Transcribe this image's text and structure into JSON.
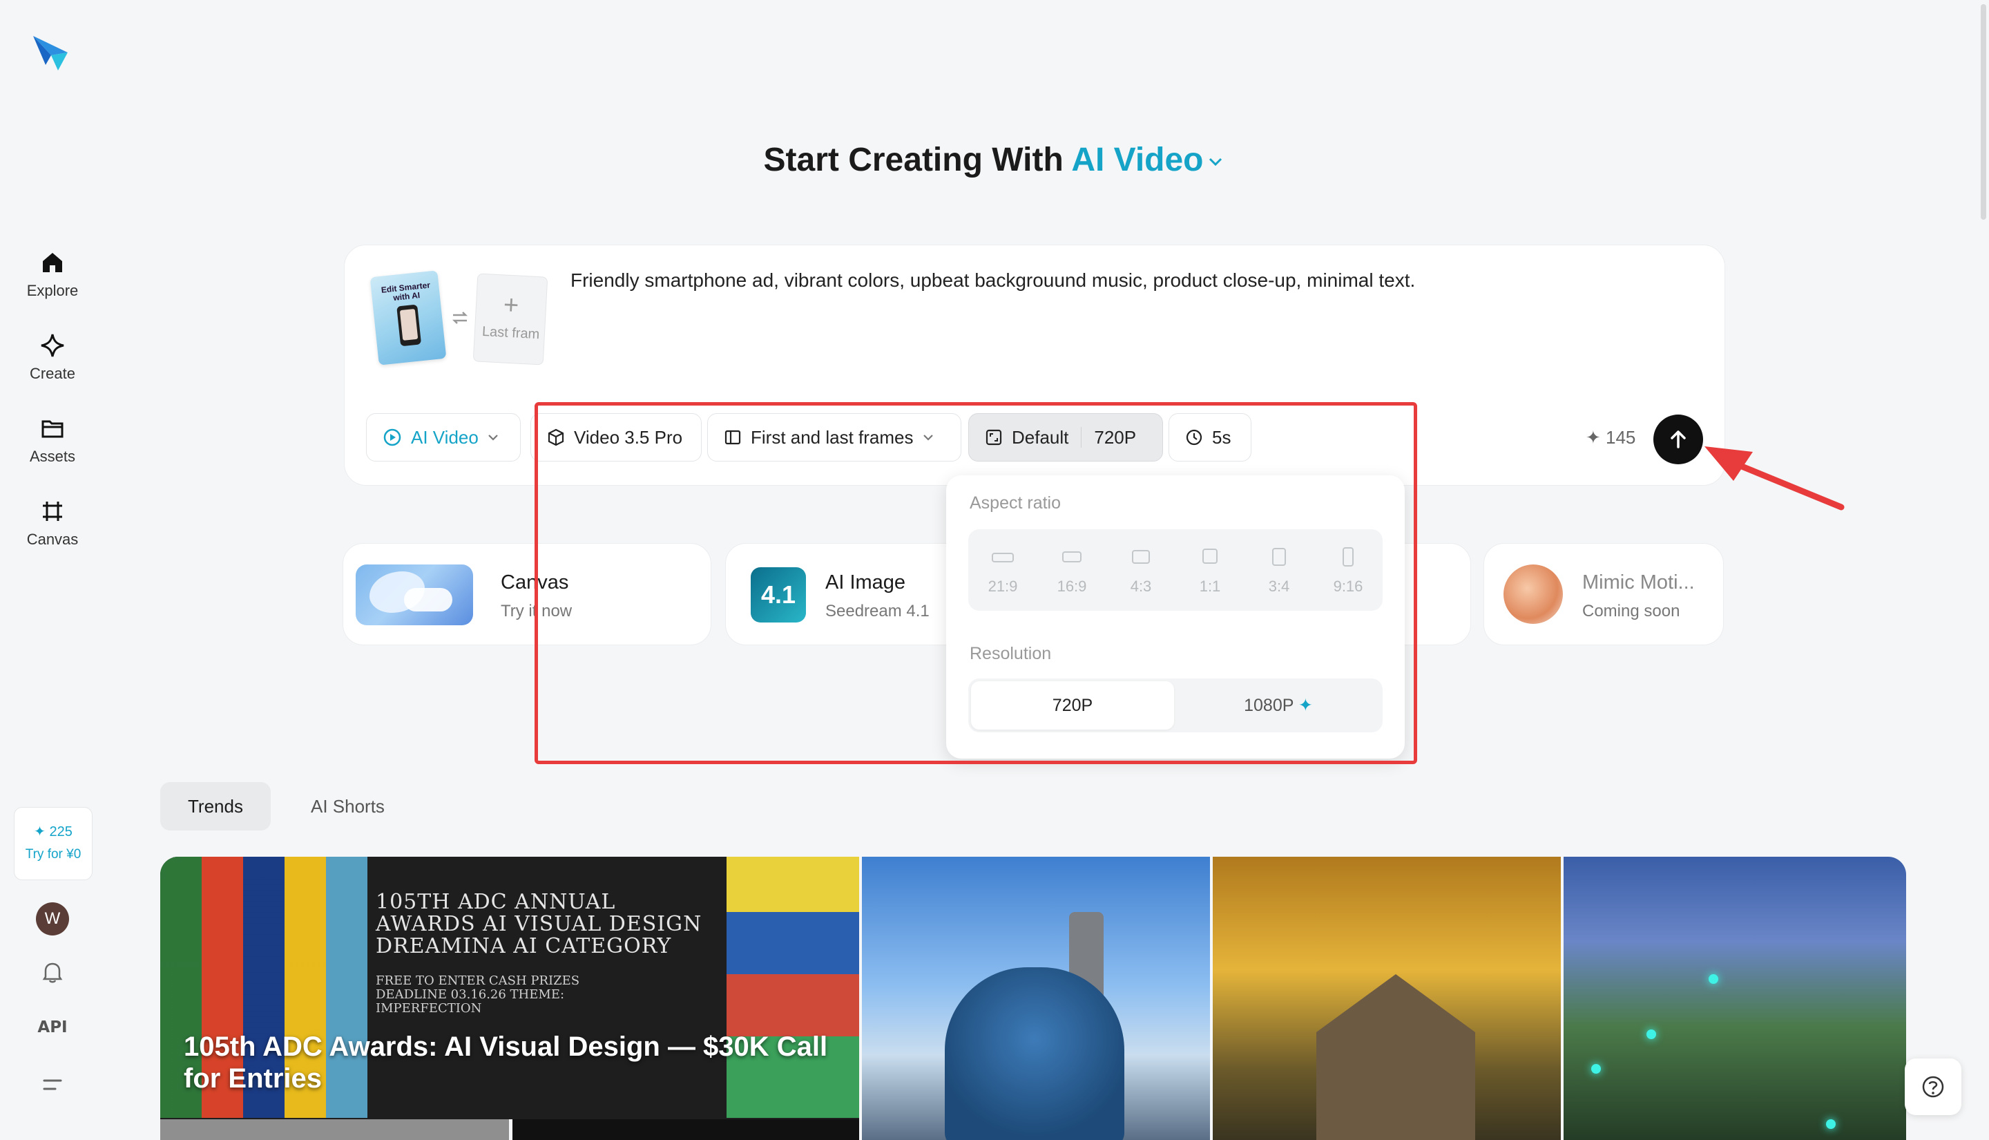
{
  "sidebar": {
    "items": [
      {
        "label": "Explore"
      },
      {
        "label": "Create"
      },
      {
        "label": "Assets"
      },
      {
        "label": "Canvas"
      }
    ],
    "credits": "✦ 225",
    "try_label": "Try for ¥0",
    "avatar_letter": "W",
    "api_label": "API"
  },
  "heading": {
    "prefix": "Start Creating With",
    "mode": "AI Video"
  },
  "prompt": {
    "first_frame_text": "Edit Smarter with AI",
    "last_frame_label": "Last fram",
    "text": "Friendly smartphone ad, vibrant colors, upbeat backgrouund music, product close-up, minimal text."
  },
  "toolbar": {
    "mode": "AI Video",
    "model": "Video 3.5 Pro",
    "frames": "First and last frames",
    "ratio": "Default",
    "resolution": "720P",
    "duration": "5s",
    "credits": "✦ 145"
  },
  "dropdown": {
    "aspect_label": "Aspect ratio",
    "aspect_options": [
      "21:9",
      "16:9",
      "4:3",
      "1:1",
      "3:4",
      "9:16"
    ],
    "resolution_label": "Resolution",
    "resolution_options": [
      "720P",
      "1080P"
    ],
    "resolution_selected": "720P"
  },
  "cards": [
    {
      "name": "Canvas",
      "sub": "Try it now"
    },
    {
      "name": "AI Image",
      "sub": "Seedream 4.1",
      "badge": "4.1"
    },
    {
      "name": "Mimic Moti...",
      "sub": "Coming soon"
    }
  ],
  "tabs": [
    "Trends",
    "AI Shorts"
  ],
  "gallery": {
    "poster_title": "105TH ADC ANNUAL AWARDS AI VISUAL DESIGN DREAMINA AI CATEGORY",
    "poster_details": "FREE TO ENTER CASH PRIZES DEADLINE 03.16.26 THEME: IMPERFECTION",
    "caption": "105th ADC Awards: AI Visual Design — $30K Call for Entries"
  },
  "colors": {
    "accent": "#15a4c7",
    "highlight": "#e83b3b",
    "send_button": "#101010"
  }
}
